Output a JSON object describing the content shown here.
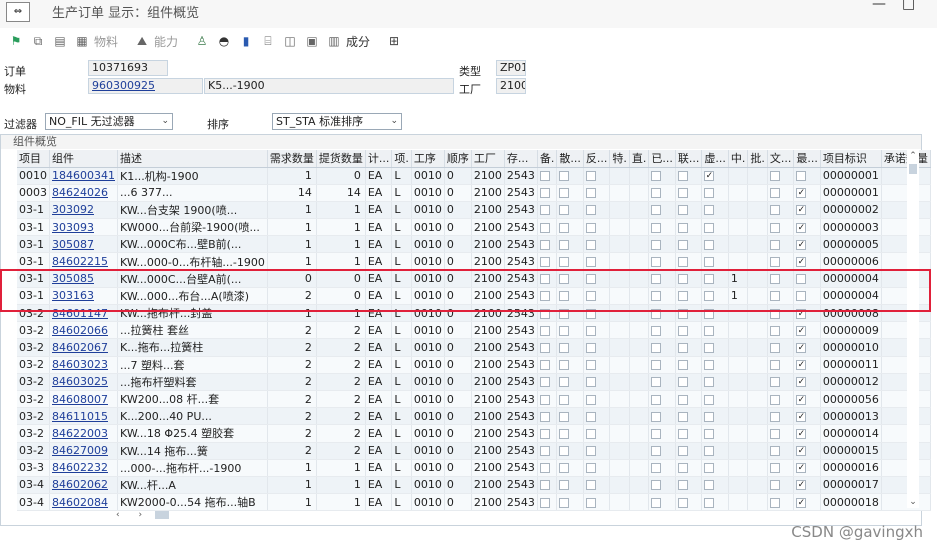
{
  "window": {
    "title": "生产订单 显示：组件概览",
    "controls": [
      "—",
      "□"
    ]
  },
  "toolbar": {
    "material_label": "物料",
    "capacity_label": "能力",
    "cost_label": "成分"
  },
  "header": {
    "order_label": "订单",
    "order_value": "10371693",
    "material_label": "物料",
    "material_value": "960300925",
    "material_desc": "K5...-1900",
    "type_label": "类型",
    "type_value": "ZP01",
    "plant_label": "工厂",
    "plant_value": "2100",
    "filter_label": "过滤器",
    "filter_value": "NO_FIL 无过滤器",
    "sort_label": "排序",
    "sort_value": "ST_STA 标准排序"
  },
  "panel": {
    "title": "组件概览"
  },
  "columns": [
    "项目",
    "组件",
    "描述",
    "需求数量",
    "提货数量",
    "计...",
    "项.",
    "工序",
    "顺序",
    "工厂",
    "存...",
    "备.",
    "散...",
    "反...",
    "特.",
    "直.",
    "已...",
    "联...",
    "虚...",
    "中.",
    "批.",
    "文...",
    "最...",
    "项目标识",
    "承诺数量"
  ],
  "rows": [
    {
      "item": "0010",
      "comp": "184600341",
      "desc": "K1...机构-1900",
      "req": "1",
      "picked": "0",
      "unit": "EA",
      "cat": "L",
      "op": "0010",
      "seq": "0",
      "plant": "2100",
      "sloc": "2543",
      "virt": true,
      "zhong": "",
      "last": false,
      "id": "00000001"
    },
    {
      "item": "0003",
      "comp": "84624026",
      "desc": "...6 377...",
      "req": "14",
      "picked": "14",
      "unit": "EA",
      "cat": "L",
      "op": "0010",
      "seq": "0",
      "plant": "2100",
      "sloc": "2543",
      "virt": false,
      "zhong": "",
      "last": true,
      "id": "00000001"
    },
    {
      "item": "03-1",
      "comp": "303092",
      "desc": "KW...台支架 1900(喷...",
      "req": "1",
      "picked": "1",
      "unit": "EA",
      "cat": "L",
      "op": "0010",
      "seq": "0",
      "plant": "2100",
      "sloc": "2543",
      "virt": false,
      "zhong": "",
      "last": true,
      "id": "00000002"
    },
    {
      "item": "03-1",
      "comp": "303093",
      "desc": "KW000...台前梁-1900(喷...",
      "req": "1",
      "picked": "1",
      "unit": "EA",
      "cat": "L",
      "op": "0010",
      "seq": "0",
      "plant": "2100",
      "sloc": "2543",
      "virt": false,
      "zhong": "",
      "last": true,
      "id": "00000003"
    },
    {
      "item": "03-1",
      "comp": "305087",
      "desc": "KW...000C布...壁B前(...",
      "req": "1",
      "picked": "1",
      "unit": "EA",
      "cat": "L",
      "op": "0010",
      "seq": "0",
      "plant": "2100",
      "sloc": "2543",
      "virt": false,
      "zhong": "",
      "last": true,
      "id": "00000005"
    },
    {
      "item": "03-1",
      "comp": "84602215",
      "desc": "KW...000-0...布杆轴...-1900",
      "req": "1",
      "picked": "1",
      "unit": "EA",
      "cat": "L",
      "op": "0010",
      "seq": "0",
      "plant": "2100",
      "sloc": "2543",
      "virt": false,
      "zhong": "",
      "last": true,
      "id": "00000006"
    },
    {
      "item": "03-1",
      "comp": "305085",
      "desc": "KW...000C...台壁A前(...",
      "req": "0",
      "picked": "0",
      "unit": "EA",
      "cat": "L",
      "op": "0010",
      "seq": "0",
      "plant": "2100",
      "sloc": "2543",
      "virt": false,
      "zhong": "1",
      "last": false,
      "id": "00000004"
    },
    {
      "item": "03-1",
      "comp": "303163",
      "desc": "KW...000...布台...A(喷漆)",
      "req": "2",
      "picked": "0",
      "unit": "EA",
      "cat": "L",
      "op": "0010",
      "seq": "0",
      "plant": "2100",
      "sloc": "2543",
      "virt": false,
      "zhong": "1",
      "last": false,
      "id": "00000004"
    },
    {
      "item": "03-2",
      "comp": "84601147",
      "desc": "KW...拖布杆...封盖",
      "req": "1",
      "picked": "1",
      "unit": "EA",
      "cat": "L",
      "op": "0010",
      "seq": "0",
      "plant": "2100",
      "sloc": "2543",
      "virt": false,
      "zhong": "",
      "last": true,
      "id": "00000008"
    },
    {
      "item": "03-2",
      "comp": "84602066",
      "desc": "...拉簧柱 套丝",
      "req": "2",
      "picked": "2",
      "unit": "EA",
      "cat": "L",
      "op": "0010",
      "seq": "0",
      "plant": "2100",
      "sloc": "2543",
      "virt": false,
      "zhong": "",
      "last": true,
      "id": "00000009"
    },
    {
      "item": "03-2",
      "comp": "84602067",
      "desc": "K...拖布...拉簧柱",
      "req": "2",
      "picked": "2",
      "unit": "EA",
      "cat": "L",
      "op": "0010",
      "seq": "0",
      "plant": "2100",
      "sloc": "2543",
      "virt": false,
      "zhong": "",
      "last": true,
      "id": "00000010"
    },
    {
      "item": "03-2",
      "comp": "84603023",
      "desc": "...7 塑料...套",
      "req": "2",
      "picked": "2",
      "unit": "EA",
      "cat": "L",
      "op": "0010",
      "seq": "0",
      "plant": "2100",
      "sloc": "2543",
      "virt": false,
      "zhong": "",
      "last": true,
      "id": "00000011"
    },
    {
      "item": "03-2",
      "comp": "84603025",
      "desc": "...拖布杆塑料套",
      "req": "2",
      "picked": "2",
      "unit": "EA",
      "cat": "L",
      "op": "0010",
      "seq": "0",
      "plant": "2100",
      "sloc": "2543",
      "virt": false,
      "zhong": "",
      "last": true,
      "id": "00000012"
    },
    {
      "item": "03-2",
      "comp": "84608007",
      "desc": "KW200...08 杆...套",
      "req": "2",
      "picked": "2",
      "unit": "EA",
      "cat": "L",
      "op": "0010",
      "seq": "0",
      "plant": "2100",
      "sloc": "2543",
      "virt": false,
      "zhong": "",
      "last": true,
      "id": "00000056"
    },
    {
      "item": "03-2",
      "comp": "84611015",
      "desc": "K...200...40 PU...",
      "req": "2",
      "picked": "2",
      "unit": "EA",
      "cat": "L",
      "op": "0010",
      "seq": "0",
      "plant": "2100",
      "sloc": "2543",
      "virt": false,
      "zhong": "",
      "last": true,
      "id": "00000013"
    },
    {
      "item": "03-2",
      "comp": "84622003",
      "desc": "KW...18 Φ25.4 塑胶套",
      "req": "2",
      "picked": "2",
      "unit": "EA",
      "cat": "L",
      "op": "0010",
      "seq": "0",
      "plant": "2100",
      "sloc": "2543",
      "virt": false,
      "zhong": "",
      "last": true,
      "id": "00000014"
    },
    {
      "item": "03-2",
      "comp": "84627009",
      "desc": "KW...14 拖布...簧",
      "req": "2",
      "picked": "2",
      "unit": "EA",
      "cat": "L",
      "op": "0010",
      "seq": "0",
      "plant": "2100",
      "sloc": "2543",
      "virt": false,
      "zhong": "",
      "last": true,
      "id": "00000015"
    },
    {
      "item": "03-3",
      "comp": "84602232",
      "desc": "...000-...拖布杆...-1900",
      "req": "1",
      "picked": "1",
      "unit": "EA",
      "cat": "L",
      "op": "0010",
      "seq": "0",
      "plant": "2100",
      "sloc": "2543",
      "virt": false,
      "zhong": "",
      "last": true,
      "id": "00000016"
    },
    {
      "item": "03-4",
      "comp": "84602062",
      "desc": "KW...杆...A",
      "req": "1",
      "picked": "1",
      "unit": "EA",
      "cat": "L",
      "op": "0010",
      "seq": "0",
      "plant": "2100",
      "sloc": "2543",
      "virt": false,
      "zhong": "",
      "last": true,
      "id": "00000017"
    },
    {
      "item": "03-4",
      "comp": "84602084",
      "desc": "KW2000-0...54 拖布...轴B",
      "req": "1",
      "picked": "1",
      "unit": "EA",
      "cat": "L",
      "op": "0010",
      "seq": "0",
      "plant": "2100",
      "sloc": "2543",
      "virt": false,
      "zhong": "",
      "last": true,
      "id": "00000018"
    }
  ],
  "watermark": "CSDN @gavingxh",
  "colors": {
    "link": "#1f3f9a",
    "highlight": "#e0203a"
  }
}
